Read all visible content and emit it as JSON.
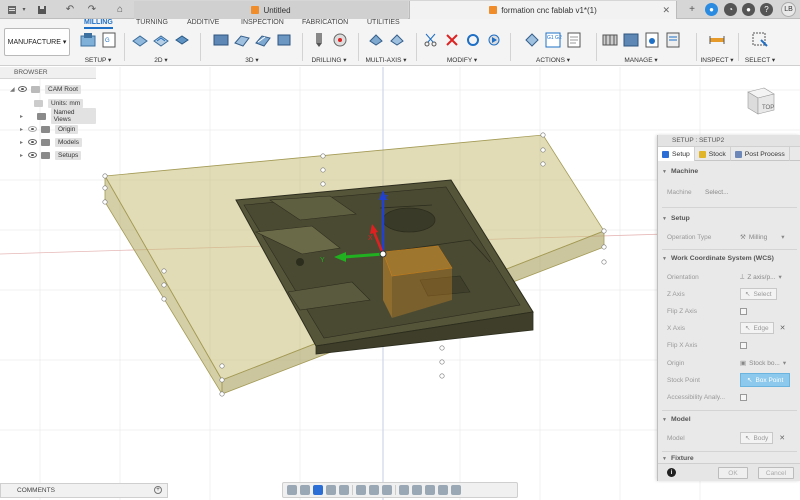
{
  "window": {
    "tabs": [
      {
        "label": "Untitled"
      },
      {
        "label": "formation cnc fablab v1*(1)"
      }
    ],
    "user_initials": "LB",
    "new_tab_label": "+"
  },
  "workspace": {
    "label": "MANUFACTURE ▾"
  },
  "ribbon": {
    "tabs": [
      "MILLING",
      "TURNING",
      "ADDITIVE",
      "INSPECTION",
      "FABRICATION",
      "UTILITIES"
    ],
    "active_tab": "MILLING",
    "groups": [
      {
        "label": "SETUP ▾"
      },
      {
        "label": "2D ▾"
      },
      {
        "label": "3D ▾"
      },
      {
        "label": "DRILLING ▾"
      },
      {
        "label": "MULTI-AXIS ▾"
      },
      {
        "label": "MODIFY ▾"
      },
      {
        "label": "ACTIONS ▾"
      },
      {
        "label": "MANAGE ▾"
      },
      {
        "label": "INSPECT ▾"
      },
      {
        "label": "SELECT ▾"
      }
    ],
    "gcode_labels": [
      "G1 G2",
      "G"
    ]
  },
  "browser": {
    "title": "BROWSER",
    "items": [
      {
        "label": "CAM Root"
      },
      {
        "label": "Units: mm"
      },
      {
        "label": "Named Views"
      },
      {
        "label": "Origin"
      },
      {
        "label": "Models"
      },
      {
        "label": "Setups"
      }
    ]
  },
  "viewport": {
    "viewcube_label": "TOP",
    "axes": {
      "x": "X",
      "y": "Y",
      "z": "Z"
    },
    "colors": {
      "stock": "#c9c07a",
      "part": "#4a4a33",
      "x_axis": "#e02020",
      "y_axis": "#20b020",
      "z_axis": "#2040d0",
      "highlight": "#e59a2a"
    }
  },
  "setup_panel": {
    "title": "SETUP : SETUP2",
    "tabs": [
      {
        "label": "Setup"
      },
      {
        "label": "Stock"
      },
      {
        "label": "Post Process"
      }
    ],
    "sections": {
      "machine": {
        "title": "Machine",
        "machine_label": "Machine",
        "machine_value": "Select..."
      },
      "setup": {
        "title": "Setup",
        "operation_type_label": "Operation Type",
        "operation_type_value": "Milling"
      },
      "wcs": {
        "title": "Work Coordinate System (WCS)",
        "orientation_label": "Orientation",
        "orientation_value": "Z axis/p...",
        "z_axis_label": "Z Axis",
        "z_axis_value": "Select",
        "flip_z_label": "Flip Z Axis",
        "x_axis_label": "X Axis",
        "x_axis_value": "Edge",
        "flip_x_label": "Flip X Axis",
        "origin_label": "Origin",
        "origin_value": "Stock bo...",
        "stock_point_label": "Stock Point",
        "stock_point_value": "Box Point",
        "accessibility_label": "Accessibility Analy..."
      },
      "model": {
        "title": "Model",
        "model_label": "Model",
        "model_value": "Body"
      },
      "fixture": {
        "title": "Fixture"
      }
    },
    "ok_label": "OK",
    "cancel_label": "Cancel",
    "info_icon": "i"
  },
  "comments": {
    "title": "COMMENTS",
    "add": "+"
  }
}
